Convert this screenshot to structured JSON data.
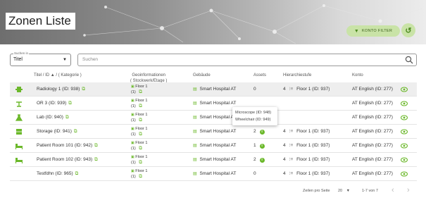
{
  "header": {
    "title": "Zonen Liste",
    "filter_label": "KONTO FILTER"
  },
  "search": {
    "select_label": "Suchen in",
    "select_value": "Titel",
    "placeholder": "Suchen"
  },
  "table": {
    "columns": {
      "title": "Titel / ID ▲ / ( Kategorie )",
      "geo_line1": "Geoinformationen",
      "geo_line2": "( Stockwerk/Etage )",
      "building": "Gebäude",
      "assets": "Assets",
      "hierarchy": "Hierarchiestufe",
      "account": "Konto"
    },
    "rows": [
      {
        "icon": "radiology-icon",
        "title": "Radiology 1 (ID: 938)",
        "floor": "Floor 1",
        "floor_num": "(1)",
        "building": "Smart Hospital AT",
        "assets": "0",
        "level": "4",
        "hierarchy": "Floor 1 (ID: 937)",
        "account": "AT English (ID: 277)"
      },
      {
        "icon": "or-icon",
        "title": "OR 3 (ID: 939)",
        "floor": "Floor 1",
        "floor_num": "(1)",
        "building": "Smart Hospital AT",
        "assets": "",
        "level": "",
        "hierarchy": "",
        "account": "AT English (ID: 277)"
      },
      {
        "icon": "lab-icon",
        "title": "Lab (ID: 940)",
        "floor": "Floor 1",
        "floor_num": "(1)",
        "building": "Smart Hospital AT",
        "assets": "",
        "level": "",
        "hierarchy": "",
        "account": "AT English (ID: 277)"
      },
      {
        "icon": "storage-icon",
        "title": "Storage (ID: 941)",
        "floor": "Floor 1",
        "floor_num": "(1)",
        "building": "Smart Hospital AT",
        "assets": "2",
        "level": "4",
        "hierarchy": "Floor 1 (ID: 937)",
        "account": "AT English (ID: 277)"
      },
      {
        "icon": "bed-icon",
        "title": "Patient Room 101 (ID: 942)",
        "floor": "Floor 1",
        "floor_num": "(1)",
        "building": "Smart Hospital AT",
        "assets": "1",
        "level": "4",
        "hierarchy": "Floor 1 (ID: 937)",
        "account": "AT English (ID: 277)"
      },
      {
        "icon": "bed-icon",
        "title": "Patient Room 102 (ID: 943)",
        "floor": "Floor 1",
        "floor_num": "(1)",
        "building": "Smart Hospital AT",
        "assets": "2",
        "level": "4",
        "hierarchy": "Floor 1 (ID: 937)",
        "account": "AT English (ID: 277)"
      },
      {
        "icon": "",
        "title": "Testfdhn (ID: 965)",
        "floor": "Floor 1",
        "floor_num": "(1)",
        "building": "Smart Hospital AT",
        "assets": "0",
        "level": "4",
        "hierarchy": "Floor 1 (ID: 937)",
        "account": "AT English (ID: 277)"
      }
    ]
  },
  "tooltip": {
    "line1": "Microscope (ID: 948)",
    "line2": "Wheelchair (ID: 949)"
  },
  "pagination": {
    "rows_per_page_label": "Zeilen pro Seite",
    "rows_per_page": "20",
    "range": "1-7 von 7"
  },
  "colors": {
    "accent": "#6bb82a",
    "filter_bg": "#c9e3a7"
  }
}
